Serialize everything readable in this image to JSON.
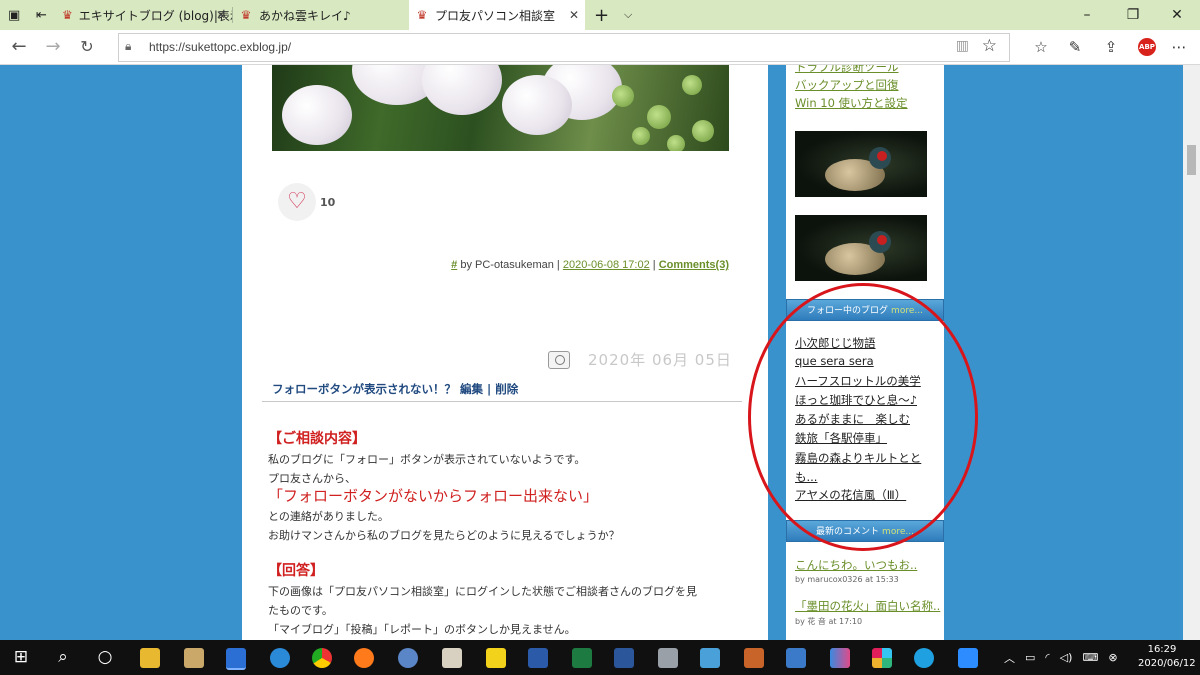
{
  "tabs": [
    {
      "label": "エキサイトブログ (blog)|表示メ",
      "active": false
    },
    {
      "label": "あかね雲キレイ♪",
      "active": false
    },
    {
      "label": "プロ友パソコン相談室",
      "active": true
    }
  ],
  "address": {
    "url": "https://sukettopc.exblog.jp/"
  },
  "post": {
    "like_count": "10",
    "meta_hash": "#",
    "meta_by": " by PC-otasukeman | ",
    "meta_date": "2020-06-08 17:02",
    "meta_sep": " | ",
    "meta_comments": "Comments(3)"
  },
  "next_post": {
    "date": "2020年  06月  05日",
    "title": "フォローボタンが表示されない！？",
    "edit": "編集",
    "delete": "削除",
    "consult_heading": "【ご相談内容】",
    "consult_lines": [
      "私のブログに「フォロー」ボタンが表示されていないようです。",
      "プロ友さんから、"
    ],
    "quote": "「フォローボタンがないからフォロー出来ない」",
    "consult_lines2": [
      "との連絡がありました。",
      "お助けマンさんから私のブログを見たらどのように見えるでしょうか？"
    ],
    "answer_heading": "【回答】",
    "answer_lines": [
      "下の画像は「プロ友パソコン相談室」にログインした状態でご相談者さんのブログを見",
      "たものです。",
      "「マイブログ」「投稿」「レポート」のボタンしか見えません。"
    ]
  },
  "sidebar": {
    "links": [
      "トラブル診断ツール",
      "バックアップと回復",
      "Win 10 使い方と設定"
    ],
    "follow_header": "フォロー中のブログ",
    "follow_more": "more...",
    "follow_blogs": [
      "小次郎じじ物語",
      "que sera sera",
      "ハーフスロットルの美学",
      "ほっと珈琲でひと息～♪",
      "あるがままに　楽しむ",
      "鉄旅「各駅停車」",
      "霧島の森よりキルトととも...",
      "アヤメの花信風（Ⅲ）"
    ],
    "comments_header": "最新のコメント",
    "comments_more": "more...",
    "comments": [
      {
        "text": "こんにちわ。いつもお..",
        "by": "by marucox0326 at 15:33"
      },
      {
        "text": "「墨田の花火」面白い名称..",
        "by": "by 花 音 at 17:10"
      }
    ]
  },
  "taskbar": {
    "time": "16:29",
    "date": "2020/06/12"
  },
  "colors": {
    "accent_green": "#6a8f2a",
    "sidebar_blue": "#3a92cc",
    "red": "#d02020"
  }
}
